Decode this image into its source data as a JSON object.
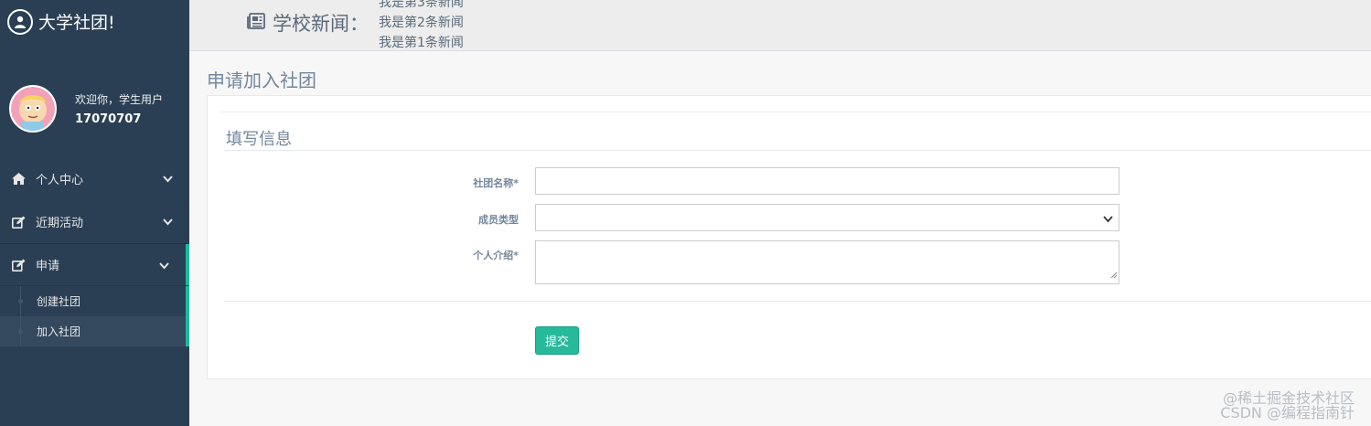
{
  "brand": {
    "title": "大学社团!",
    "icon": "user-circle-icon"
  },
  "profile": {
    "welcome": "欢迎你，学生用户",
    "username": "17070707"
  },
  "menu": {
    "items": [
      {
        "label": "个人中心",
        "icon": "home-icon"
      },
      {
        "label": "近期活动",
        "icon": "edit-icon"
      },
      {
        "label": "申请",
        "icon": "edit-icon"
      }
    ],
    "submenu": [
      {
        "label": "创建社团"
      },
      {
        "label": "加入社团"
      }
    ]
  },
  "topnav": {
    "news_label": "学校新闻：",
    "news_items": [
      "我是第3条新闻",
      "我是第2条新闻",
      "我是第1条新闻"
    ]
  },
  "page": {
    "title": "申请加入社团"
  },
  "form": {
    "panel_title": "填写信息",
    "club_name_label": "社团名称*",
    "club_name_value": "",
    "member_type_label": "成员类型",
    "member_type_value": "",
    "intro_label": "个人介绍*",
    "intro_value": "",
    "submit_label": "提交"
  },
  "watermark": {
    "line1": "@稀土掘金技术社区",
    "line2": "CSDN @编程指南针"
  },
  "colors": {
    "sidebar": "#2a3f54",
    "accent": "#1ABB9C",
    "button": "#26B99A",
    "text": "#73879C"
  }
}
